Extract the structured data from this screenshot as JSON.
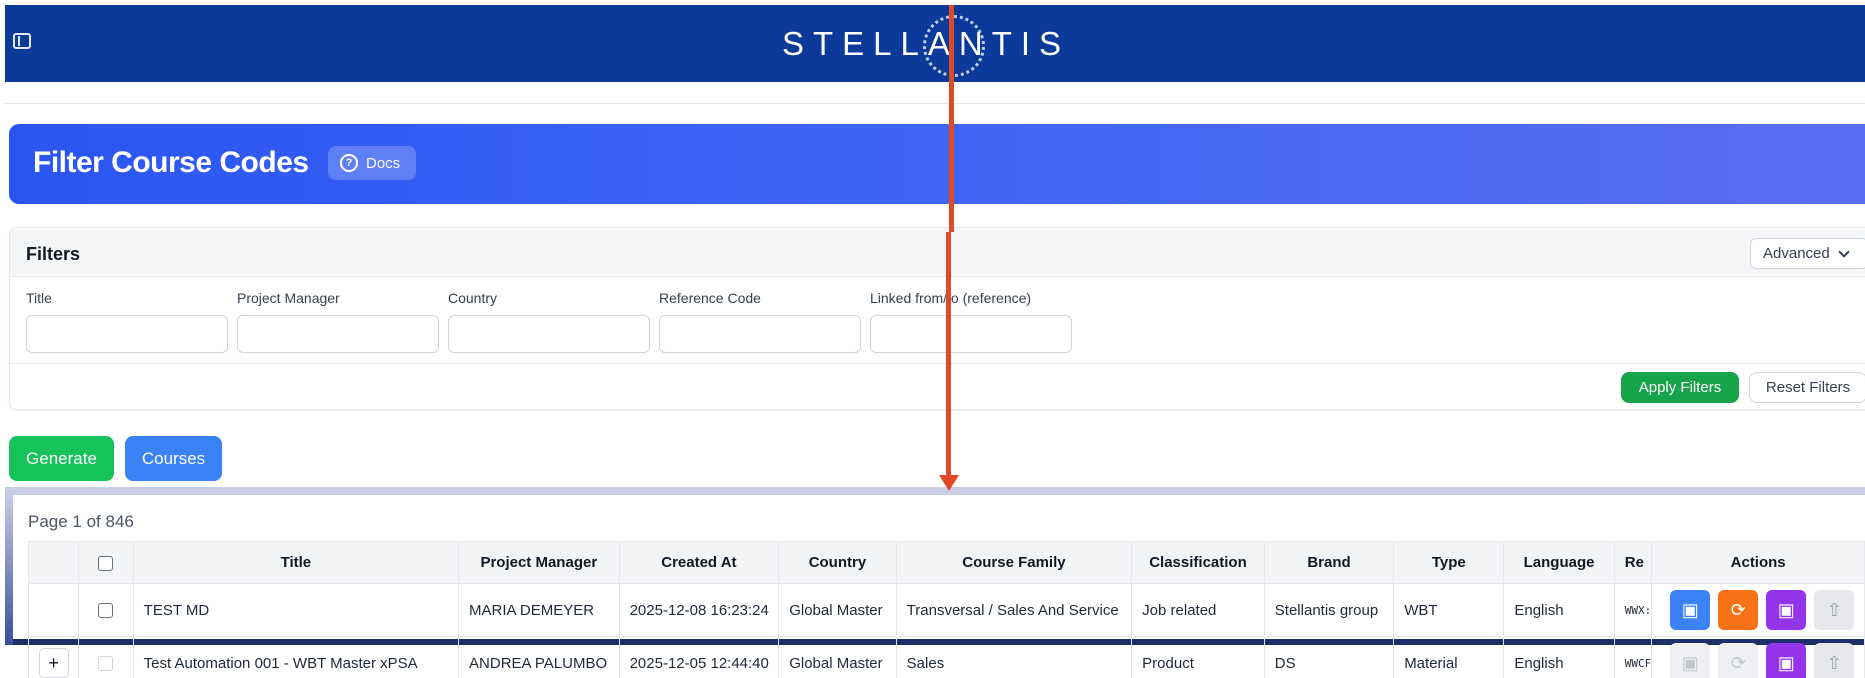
{
  "header": {
    "brand": "STELLANTIS",
    "menu_icon": "sidebar-toggle-icon"
  },
  "hero": {
    "title": "Filter Course Codes",
    "docs_label": "Docs",
    "docs_icon": "help-circle-icon"
  },
  "filters": {
    "title": "Filters",
    "advanced_label": "Advanced",
    "fields": [
      {
        "label": "Title",
        "value": ""
      },
      {
        "label": "Project Manager",
        "value": ""
      },
      {
        "label": "Country",
        "value": ""
      },
      {
        "label": "Reference Code",
        "value": ""
      },
      {
        "label": "Linked from/to (reference)",
        "value": ""
      }
    ],
    "apply_label": "Apply Filters",
    "reset_label": "Reset Filters"
  },
  "toolbar": {
    "generate_label": "Generate",
    "courses_label": "Courses"
  },
  "table": {
    "page_info": "Page 1 of 846",
    "columns": [
      "Title",
      "Project Manager",
      "Created At",
      "Country",
      "Course Family",
      "Classification",
      "Brand",
      "Type",
      "Language",
      "Re",
      "Actions"
    ],
    "rows": [
      {
        "expand": "",
        "title": "TEST MD",
        "project_manager": "MARIA DEMEYER",
        "created_at": "2025-12-08 16:23:24",
        "country": "Global Master",
        "course_family": "Transversal / Sales And Service",
        "classification": "Job related",
        "brand": "Stellantis group",
        "type": "WBT",
        "language": "English",
        "ref": "WWX:"
      },
      {
        "expand": "+",
        "title": "Test Automation 001 - WBT Master xPSA",
        "project_manager": "ANDREA PALUMBO",
        "created_at": "2025-12-05 12:44:40",
        "country": "Global Master",
        "course_family": "Sales",
        "classification": "Product",
        "brand": "DS",
        "type": "Material",
        "language": "English",
        "ref": "WWCF"
      }
    ]
  },
  "colors": {
    "header_bg": "#0b3a9b",
    "hero_bg": "#2a55f2",
    "generate": "#16c25a",
    "courses": "#3b82f6",
    "apply": "#16a34a",
    "annotation_arrow": "#e04a26"
  }
}
